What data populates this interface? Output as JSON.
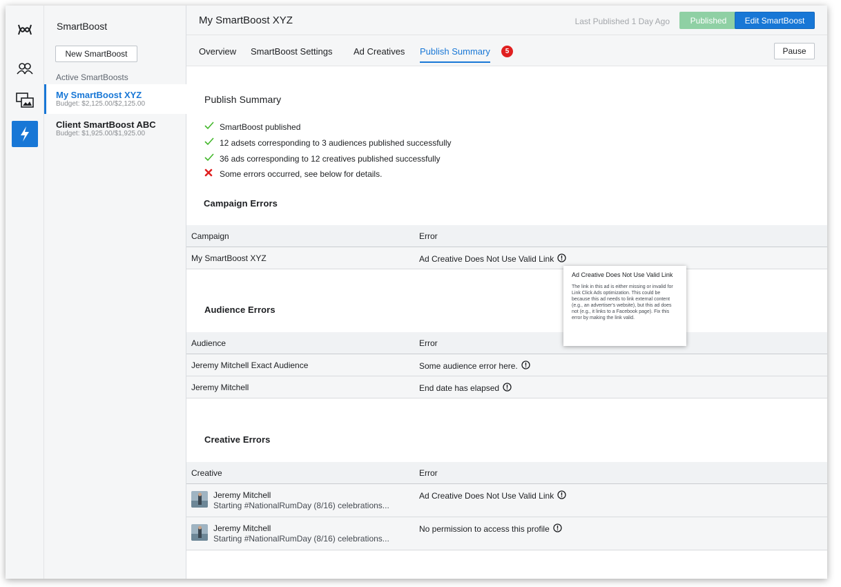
{
  "sidebar": {
    "title": "SmartBoost",
    "new_button": "New SmartBoost",
    "section_label": "Active SmartBoosts",
    "items": [
      {
        "name": "My SmartBoost XYZ",
        "budget": "Budget: $2,125.00/$2,125.00"
      },
      {
        "name": "Client SmartBoost ABC",
        "budget": "Budget: $1,925.00/$1,925.00"
      }
    ]
  },
  "rail": {
    "icons": [
      "brand-logo-icon",
      "audiences-icon",
      "creatives-icon",
      "smartboost-bolt-icon"
    ]
  },
  "header": {
    "title": "My SmartBoost XYZ",
    "last_published": "Last Published 1 Day Ago",
    "published_button": "Published",
    "edit_button": "Edit SmartBoost"
  },
  "tabs": {
    "items": [
      "Overview",
      "SmartBoost Settings",
      "Ad Creatives",
      "Publish Summary"
    ],
    "badge": "5",
    "pause_button": "Pause"
  },
  "summary": {
    "title": "Publish Summary",
    "lines": [
      "SmartBoost published",
      "12 adsets corresponding to 3 audiences published successfully",
      "36 ads corresponding to 12 creatives published successfully",
      "Some errors occurred, see below for details."
    ]
  },
  "campaign_errors": {
    "title": "Campaign Errors",
    "col1": "Campaign",
    "col2": "Error",
    "rows": [
      {
        "name": "My SmartBoost XYZ",
        "error": "Ad Creative Does Not Use Valid Link"
      }
    ]
  },
  "audience_errors": {
    "title": "Audience Errors",
    "col1": "Audience",
    "col2": "Error",
    "rows": [
      {
        "name": "Jeremy Mitchell Exact Audience",
        "error": "Some audience error here."
      },
      {
        "name": "Jeremy Mitchell",
        "error": "End date has elapsed"
      }
    ]
  },
  "creative_errors": {
    "title": "Creative Errors",
    "col1": "Creative",
    "col2": "Error",
    "rows": [
      {
        "name": "Jeremy Mitchell",
        "text": "Starting #NationalRumDay (8/16) celebrations...",
        "error": "Ad Creative Does Not Use Valid Link"
      },
      {
        "name": "Jeremy Mitchell",
        "text": "Starting #NationalRumDay (8/16) celebrations...",
        "error": "No permission to access this profile"
      }
    ]
  },
  "tooltip": {
    "title": "Ad Creative Does Not Use Valid Link",
    "body": "The link in this ad is either missing or invalid for Link Click Ads optimization. This could be because this ad needs to link external content (e.g., an advertiser's website), but this ad does not (e.g., it links to a Facebook page). Fix this error by making the link valid."
  },
  "colors": {
    "accent": "#1877d6",
    "success": "#42b72a",
    "error": "#e02020",
    "published": "#8fd0a4"
  }
}
